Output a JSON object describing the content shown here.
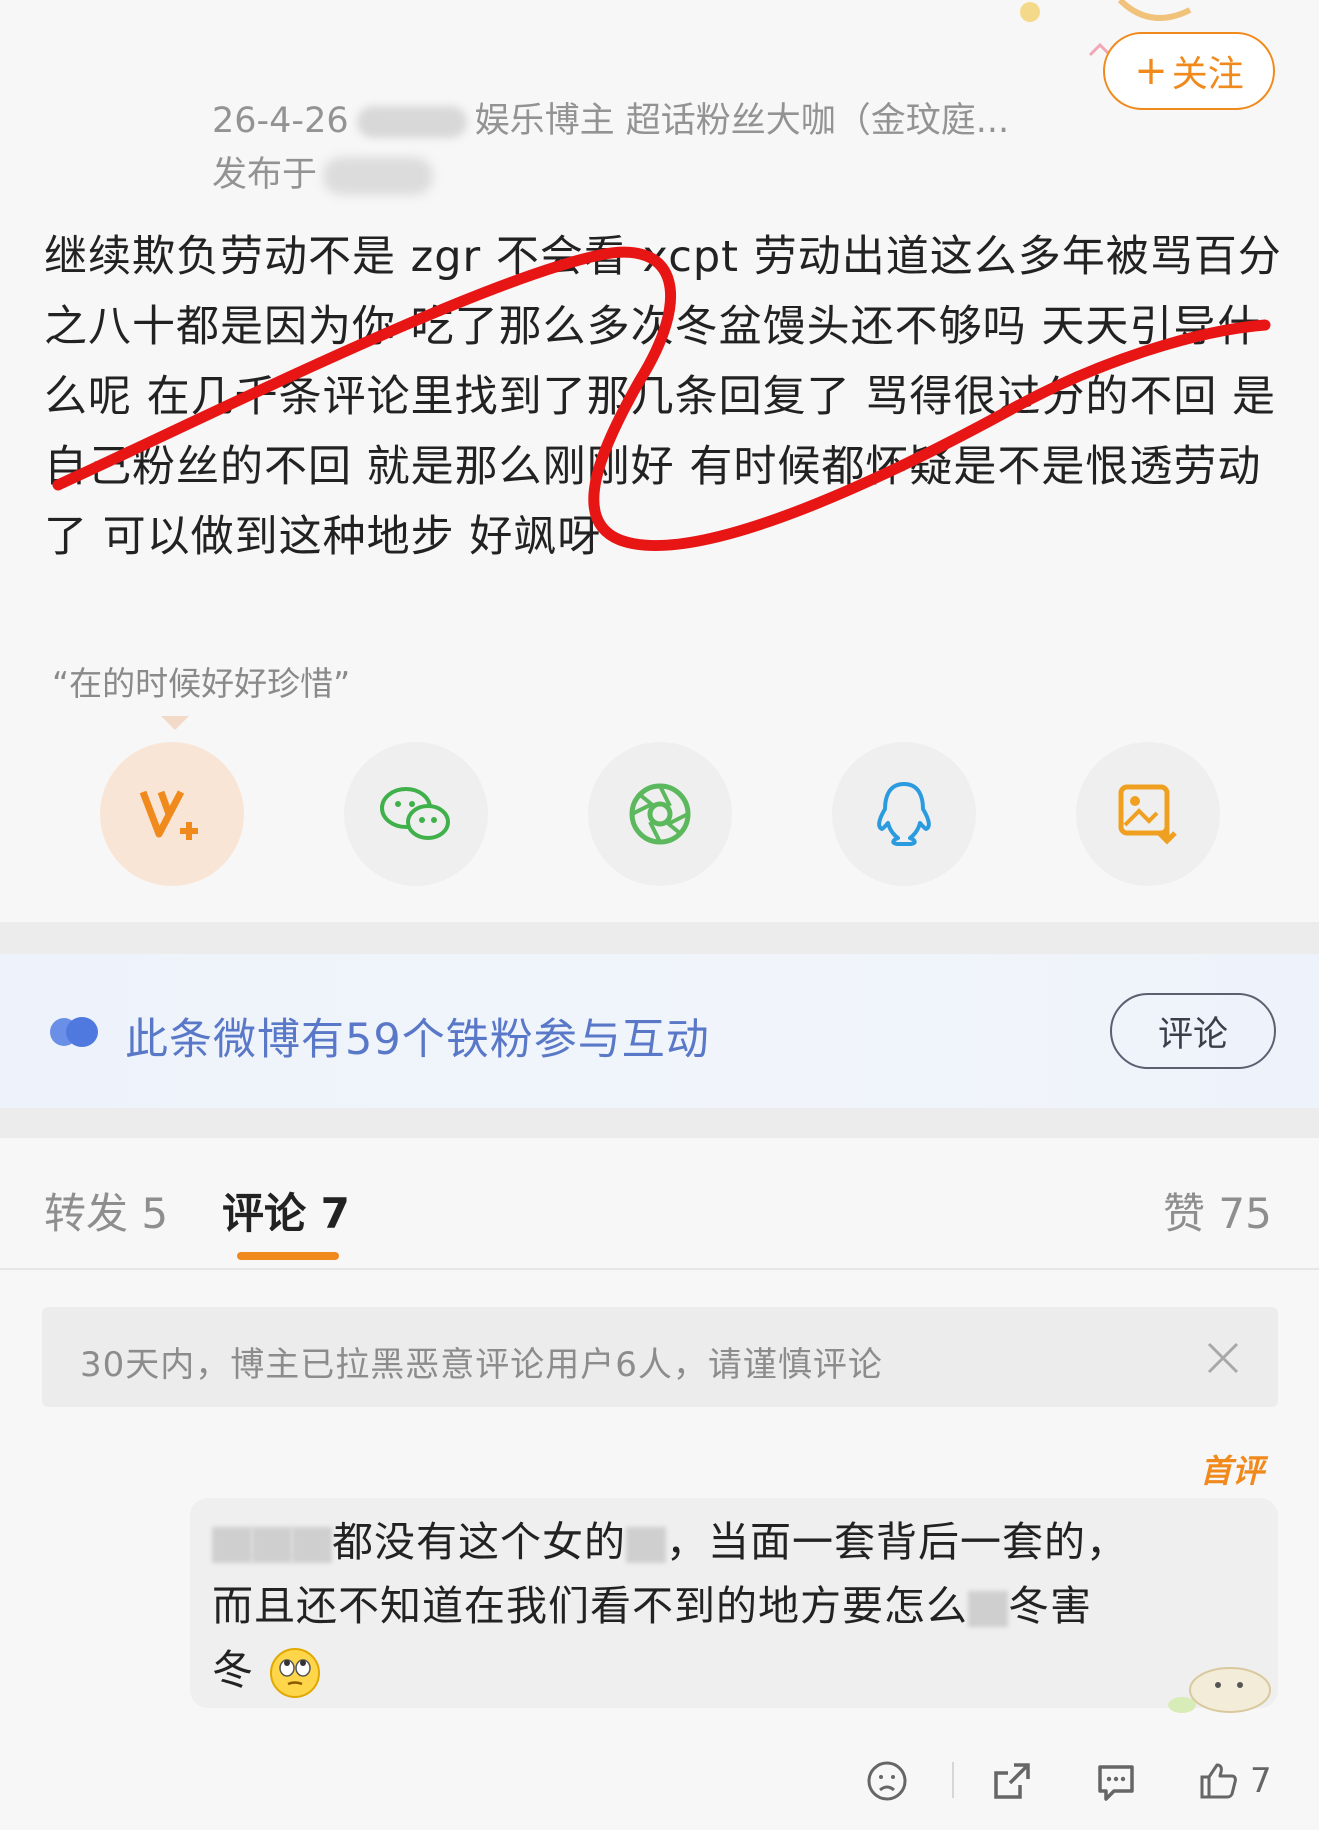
{
  "header": {
    "date_prefix": "26-4-26",
    "blogger_tags": "娱乐博主 超话粉丝大咖（金玟庭...",
    "published_label": "发布于",
    "follow_label": "关注",
    "follow_plus": "+"
  },
  "post": {
    "text": "继续欺负劳动不是 zgr 不会看 xcpt 劳动出道这么多年被骂百分之八十都是因为你 吃了那么多次冬盆馒头还不够吗 天天引导什么呢 在几千条评论里找到了那几条回复了 骂得很过分的不回 是自己粉丝的不回 就是那么刚刚好 有时候都怀疑是不是恨透劳动了 可以做到这种地步 好飒呀",
    "quote": "“在的时候好好珍惜”"
  },
  "share": {
    "items": [
      {
        "icon": "weibo-vplus-icon"
      },
      {
        "icon": "wechat-icon"
      },
      {
        "icon": "moments-icon"
      },
      {
        "icon": "qq-icon"
      },
      {
        "icon": "save-image-icon"
      }
    ]
  },
  "fans": {
    "text": "此条微博有59个铁粉参与互动",
    "button_label": "评论",
    "accent_color": "#5a78c8"
  },
  "tabs": {
    "repost": "转发 5",
    "comments": "评论 7",
    "likes": "赞 75",
    "accent_color": "#f08a1c"
  },
  "notice": {
    "text": "30天内，博主已拉黑恶意评论用户6人，请谨慎评论"
  },
  "comment": {
    "badge": "首评",
    "text_part1": "都没有这个女的",
    "text_part2": "，当面一套背后一套的，",
    "text_line2": "而且还不知道在我们看不到的地方要怎么",
    "text_line2_end": "冬害",
    "text_line3": "冬",
    "like_count": "7"
  }
}
